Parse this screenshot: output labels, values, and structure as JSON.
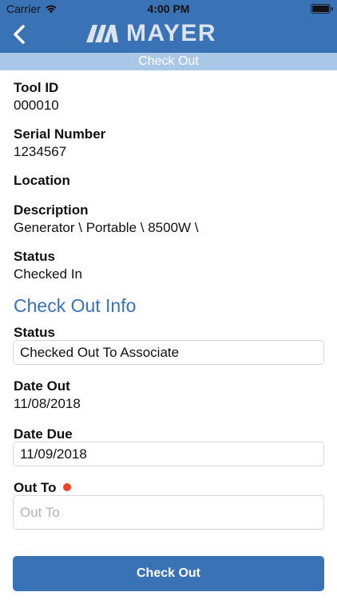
{
  "status_bar": {
    "carrier": "Carrier",
    "time": "4:00 PM",
    "battery_level": 1.0
  },
  "header": {
    "logo_text": "MAYER",
    "subtitle": "Check Out",
    "brand_color": "#3a72b6",
    "subheader_color": "#a9c8e7"
  },
  "tool": {
    "tool_id_label": "Tool ID",
    "tool_id": "000010",
    "serial_label": "Serial Number",
    "serial": "1234567",
    "location_label": "Location",
    "location": "",
    "description_label": "Description",
    "description": "Generator \\ Portable \\ 8500W \\",
    "status_label": "Status",
    "status": "Checked In"
  },
  "checkout": {
    "section_title": "Check Out Info",
    "status_label": "Status",
    "status_value": "Checked Out To Associate",
    "date_out_label": "Date Out",
    "date_out": "11/08/2018",
    "date_due_label": "Date Due",
    "date_due": "11/09/2018",
    "out_to_label": "Out To",
    "out_to_placeholder": "Out To",
    "required_color": "#ee4422"
  },
  "actions": {
    "check_out_label": "Check Out"
  }
}
